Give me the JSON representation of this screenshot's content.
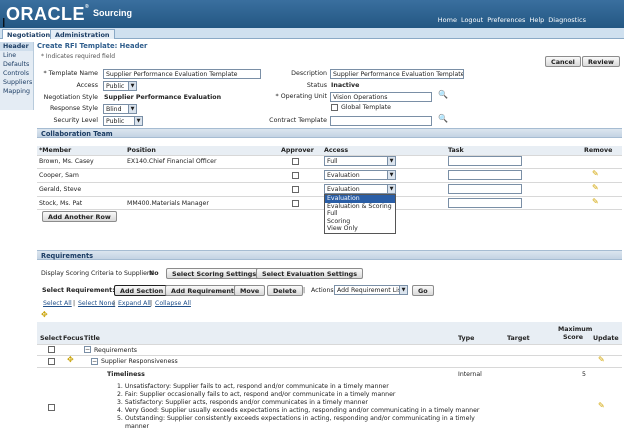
{
  "header": {
    "logo": "ORACLE",
    "app_name": "Sourcing",
    "global_links": [
      "Home",
      "Logout",
      "Preferences",
      "Help",
      "Diagnostics"
    ]
  },
  "tabs": [
    "Negotiations",
    "Administration"
  ],
  "sidenav": [
    "Header",
    "Line",
    "Defaults",
    "Controls",
    "Suppliers",
    "Mapping"
  ],
  "page": {
    "title": "Create RFI Template: Header",
    "required_note": "* Indicates required field",
    "cancel": "Cancel",
    "review": "Review"
  },
  "form": {
    "template_name_label": "* Template Name",
    "template_name_value": "Supplier Performance Evaluation Template",
    "access_label": "Access",
    "access_value": "Public",
    "negotiation_style_label": "Negotiation Style",
    "negotiation_style_value": "Supplier Performance Evaluation",
    "response_style_label": "Response Style",
    "response_style_value": "Blind",
    "security_level_label": "Security Level",
    "security_level_value": "Public",
    "description_label": "Description",
    "description_value": "Supplier Performance Evaluation Template",
    "status_label": "Status",
    "status_value": "Inactive",
    "operating_unit_label": "* Operating Unit",
    "operating_unit_value": "Vision Operations",
    "global_template_label": "Global Template",
    "contract_template_label": "Contract Template"
  },
  "collab": {
    "title": "Collaboration Team",
    "columns": [
      "*Member",
      "Position",
      "Approver",
      "Access",
      "Task",
      "Remove"
    ],
    "rows": [
      {
        "member": "Brown, Ms. Casey",
        "position": "EX140.Chief Financial Officer",
        "access": "Full"
      },
      {
        "member": "Cooper, Sam",
        "position": "",
        "access": "Evaluation"
      },
      {
        "member": "Gerald, Steve",
        "position": "",
        "access": "Evaluation"
      },
      {
        "member": "Stock, Ms. Pat",
        "position": "MM400.Materials Manager",
        "access": ""
      }
    ],
    "add_row": "Add Another Row",
    "dropdown_options": [
      "Evaluation",
      "Evaluation & Scoring",
      "Full",
      "Scoring",
      "View Only"
    ]
  },
  "requirements": {
    "title": "Requirements",
    "display_scoring_label": "Display Scoring Criteria to Suppliers",
    "display_scoring_value": "No",
    "select_scoring": "Select Scoring Settings",
    "select_evaluation": "Select Evaluation Settings",
    "select_requirement_label": "Select Requirement:",
    "add_section": "Add Section",
    "add_requirement": "Add Requirement",
    "move": "Move",
    "delete": "Delete",
    "actions_label": "Actions",
    "actions_value": "Add Requirement List",
    "go": "Go",
    "select_all": "Select All",
    "select_none": "Select None",
    "expand_all": "Expand All",
    "collapse_all": "Collapse All",
    "columns": [
      "Select",
      "Focus",
      "Title",
      "Type",
      "Target",
      "Maximum Score",
      "Update"
    ],
    "tree_root": "Requirements",
    "tree_section": "Supplier Responsiveness",
    "item_title": "Timeliness",
    "item_type": "Internal",
    "item_score": "5",
    "item_lines": [
      "1.  Unsatisfactory: Supplier fails to act, respond and/or communicate in a timely manner",
      "2.  Fair: Supplier occasionally fails to act, respond and/or communicate in a timely manner",
      "3.  Satisfactory: Supplier acts, responds and/or communicates in a timely manner",
      "4.  Very Good: Supplier usually exceeds expectations in acting, responding and/or communicating in a timely manner",
      "5.  Outstanding: Supplier consistently exceeds expectations in acting, responding and/or communicating in a timely",
      "manner"
    ]
  }
}
